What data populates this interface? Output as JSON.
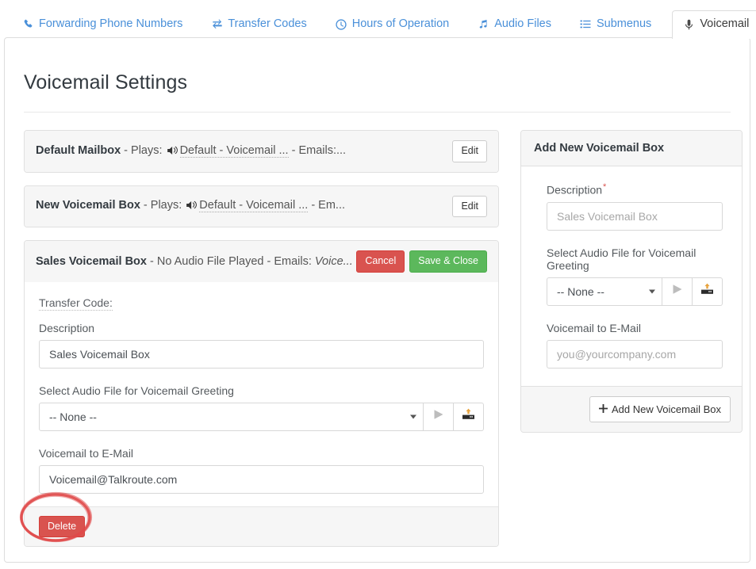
{
  "tabs": [
    {
      "label": "Forwarding Phone Numbers",
      "icon": "phone-icon",
      "active": false
    },
    {
      "label": "Transfer Codes",
      "icon": "exchange-icon",
      "active": false
    },
    {
      "label": "Hours of Operation",
      "icon": "clock-icon",
      "active": false
    },
    {
      "label": "Audio Files",
      "icon": "music-note-icon",
      "active": false
    },
    {
      "label": "Submenus",
      "icon": "list-icon",
      "active": false
    },
    {
      "label": "Voicemail",
      "icon": "microphone-icon",
      "active": true
    }
  ],
  "page": {
    "title": "Voicemail Settings"
  },
  "mailboxes": [
    {
      "name": "Default Mailbox",
      "plays_label": " - Plays: ",
      "plays_value": "Default - Voicemail ...",
      "emails_label": " - Emails:...",
      "emails_value": "",
      "has_speaker_icon": true,
      "edit_label": "Edit",
      "expanded": false
    },
    {
      "name": "New Voicemail Box",
      "plays_label": " - Plays: ",
      "plays_value": "Default - Voicemail ...",
      "emails_label": " - Em...",
      "emails_value": "",
      "has_speaker_icon": true,
      "edit_label": "Edit",
      "expanded": false
    },
    {
      "name": "Sales Voicemail Box",
      "plays_label": " - No Audio File Played",
      "plays_value": "",
      "emails_label": " - Emails: ",
      "emails_value": "Voice...",
      "has_speaker_icon": false,
      "cancel_label": "Cancel",
      "save_label": "Save & Close",
      "expanded": true
    }
  ],
  "edit_form": {
    "transfer_code_label": "Transfer Code:",
    "description_label": "Description",
    "description_value": "Sales Voicemail Box",
    "audio_label": "Select Audio File for Voicemail Greeting",
    "audio_selected": "-- None --",
    "audio_options": [
      "-- None --"
    ],
    "email_label": "Voicemail to E-Mail",
    "email_value": "Voicemail@Talkroute.com",
    "delete_label": "Delete",
    "play_icon": "play-icon",
    "upload_icon": "upload-icon"
  },
  "add_panel": {
    "title": "Add New Voicemail Box",
    "description_label": "Description",
    "description_required": "*",
    "description_placeholder": "Sales Voicemail Box",
    "audio_label": "Select Audio File for Voicemail Greeting",
    "audio_selected": "-- None --",
    "audio_options": [
      "-- None --"
    ],
    "email_label": "Voicemail to E-Mail",
    "email_placeholder": "you@yourcompany.com",
    "submit_label": "Add New Voicemail Box",
    "play_icon": "play-icon",
    "upload_icon": "upload-icon"
  },
  "colors": {
    "tab_link": "#4a90d9",
    "danger": "#d9534f",
    "success": "#5cb85c",
    "annotation": "#e04a4a"
  }
}
